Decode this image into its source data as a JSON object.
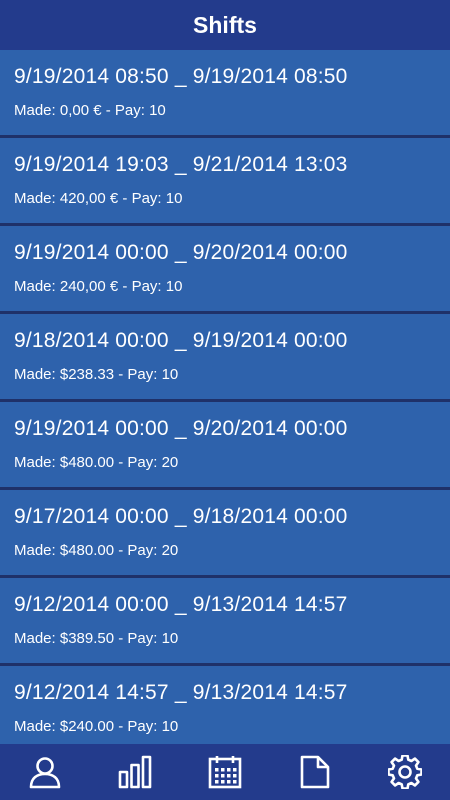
{
  "header": {
    "title": "Shifts"
  },
  "shifts": [
    {
      "range": "9/19/2014 08:50 _ 9/19/2014 08:50",
      "summary": "Made: 0,00 € - Pay: 10"
    },
    {
      "range": "9/19/2014 19:03 _ 9/21/2014 13:03",
      "summary": "Made: 420,00 € - Pay: 10"
    },
    {
      "range": "9/19/2014 00:00 _ 9/20/2014 00:00",
      "summary": "Made: 240,00 € - Pay: 10"
    },
    {
      "range": "9/18/2014 00:00 _ 9/19/2014 00:00",
      "summary": "Made: $238.33 - Pay: 10"
    },
    {
      "range": "9/19/2014 00:00 _ 9/20/2014 00:00",
      "summary": "Made: $480.00 - Pay: 20"
    },
    {
      "range": "9/17/2014 00:00 _ 9/18/2014 00:00",
      "summary": "Made: $480.00 - Pay: 20"
    },
    {
      "range": "9/12/2014 00:00 _ 9/13/2014 14:57",
      "summary": "Made: $389.50 - Pay: 10"
    },
    {
      "range": "9/12/2014 14:57 _ 9/13/2014 14:57",
      "summary": "Made: $240.00 - Pay: 10"
    }
  ],
  "tabbar": {
    "items": [
      {
        "icon": "person-icon"
      },
      {
        "icon": "bar-chart-icon"
      },
      {
        "icon": "calendar-icon"
      },
      {
        "icon": "document-icon"
      },
      {
        "icon": "gear-icon"
      }
    ]
  },
  "colors": {
    "header": "#233b8c",
    "row": "#2e62ac",
    "separator": "#1f3169",
    "text": "#ffffff"
  }
}
